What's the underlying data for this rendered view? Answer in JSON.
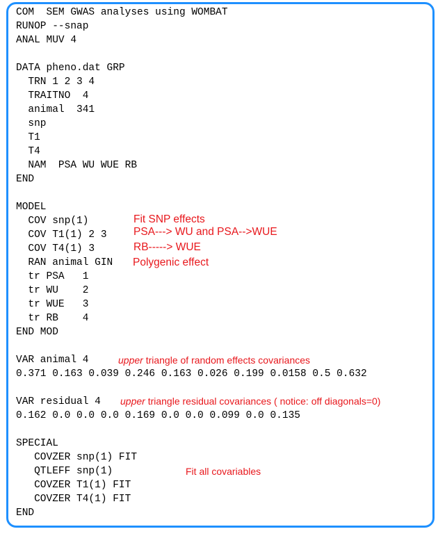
{
  "code_lines": [
    "COM  SEM GWAS analyses using WOMBAT",
    "RUNOP --snap",
    "ANAL MUV 4",
    "",
    "DATA pheno.dat GRP",
    "  TRN 1 2 3 4",
    "  TRAITNO  4",
    "  animal  341",
    "  snp",
    "  T1",
    "  T4",
    "  NAM  PSA WU WUE RB",
    "END",
    "",
    "MODEL",
    "  COV snp(1)",
    "  COV T1(1) 2 3",
    "  COV T4(1) 3",
    "  RAN animal GIN",
    "  tr PSA   1",
    "  tr WU    2",
    "  tr WUE   3",
    "  tr RB    4",
    "END MOD",
    "",
    "VAR animal 4",
    "0.371 0.163 0.039 0.246 0.163 0.026 0.199 0.0158 0.5 0.632",
    "",
    "VAR residual 4",
    "0.162 0.0 0.0 0.0 0.169 0.0 0.0 0.099 0.0 0.135",
    "",
    "SPECIAL",
    "   COVZER snp(1) FIT",
    "   QTLEFF snp(1)",
    "   COVZER T1(1) FIT",
    "   COVZER T4(1) FIT",
    "END"
  ],
  "annotations": {
    "fit_snp": "Fit SNP effects",
    "psa_wu_wue": "PSA---> WU and PSA-->WUE",
    "rb_wue": "RB-----> WUE",
    "polygenic": "Polygenic effect",
    "animal_cov_em": "upper",
    "animal_cov_rest": " triangle of random effects covariances",
    "residual_cov_em": "upper",
    "residual_cov_rest": " triangle residual covariances ( notice: off diagonals=0)",
    "fit_all": "Fit all covariables"
  },
  "colors": {
    "border": "#1e90ff",
    "annotation": "#e8171c",
    "text": "#000000"
  }
}
